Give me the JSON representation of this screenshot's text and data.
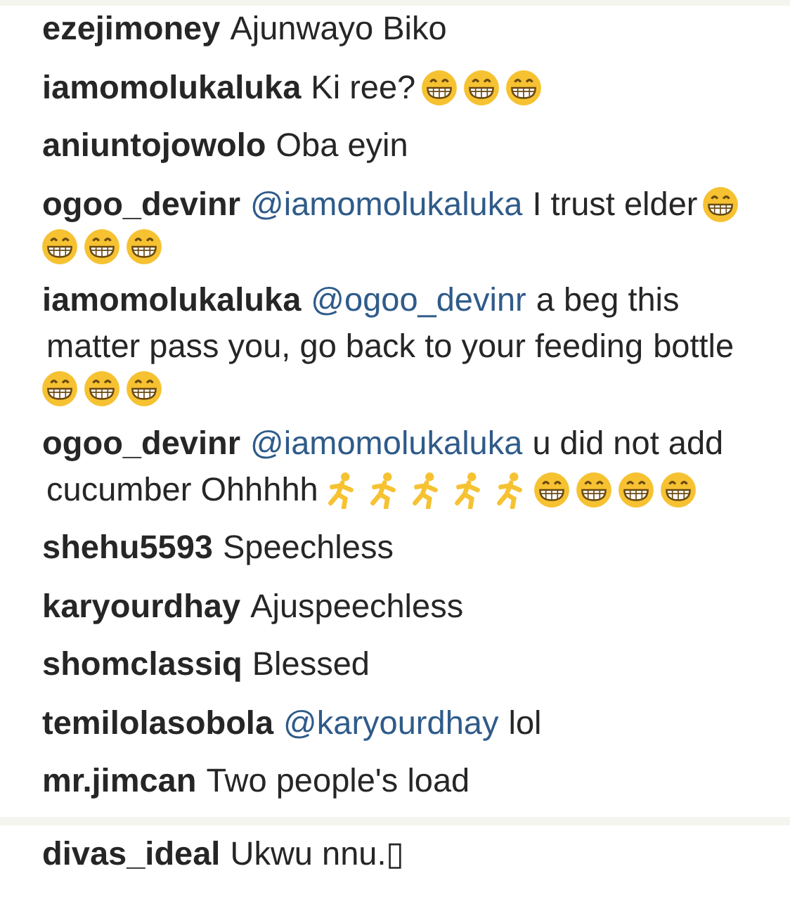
{
  "sections": [
    {
      "comments": [
        {
          "user": "ezejimoney",
          "parts": [
            {
              "kind": "text",
              "text": "Ajunwayo Biko"
            }
          ]
        },
        {
          "user": "iamomolukaluka",
          "parts": [
            {
              "kind": "text",
              "text": "Ki ree?"
            },
            {
              "kind": "grin"
            },
            {
              "kind": "grin"
            },
            {
              "kind": "grin"
            }
          ]
        },
        {
          "user": "aniuntojowolo",
          "parts": [
            {
              "kind": "text",
              "text": "Oba eyin"
            }
          ]
        },
        {
          "user": "ogoo_devinr",
          "parts": [
            {
              "kind": "mention",
              "text": "@iamomolukaluka"
            },
            {
              "kind": "text",
              "text": "I trust elder"
            },
            {
              "kind": "grin"
            },
            {
              "kind": "grin"
            },
            {
              "kind": "grin"
            },
            {
              "kind": "grin"
            }
          ]
        },
        {
          "user": "iamomolukaluka",
          "parts": [
            {
              "kind": "mention",
              "text": "@ogoo_devinr"
            },
            {
              "kind": "text",
              "text": "a beg this"
            },
            {
              "kind": "text",
              "text": "matter pass you, go back to your feeding"
            },
            {
              "kind": "text",
              "text": "bottle"
            },
            {
              "kind": "grin"
            },
            {
              "kind": "grin"
            },
            {
              "kind": "grin"
            }
          ]
        },
        {
          "user": "ogoo_devinr",
          "parts": [
            {
              "kind": "mention",
              "text": "@iamomolukaluka"
            },
            {
              "kind": "text",
              "text": "u did not add"
            },
            {
              "kind": "text",
              "text": "cucumber Ohhhhh"
            },
            {
              "kind": "run"
            },
            {
              "kind": "run"
            },
            {
              "kind": "run"
            },
            {
              "kind": "run"
            },
            {
              "kind": "run"
            },
            {
              "kind": "grin"
            },
            {
              "kind": "grin"
            },
            {
              "kind": "grin"
            },
            {
              "kind": "grin"
            }
          ]
        },
        {
          "user": "shehu5593",
          "parts": [
            {
              "kind": "text",
              "text": "Speechless"
            }
          ]
        },
        {
          "user": "karyourdhay",
          "parts": [
            {
              "kind": "text",
              "text": "Ajuspeechless"
            }
          ]
        },
        {
          "user": "shomclassiq",
          "parts": [
            {
              "kind": "text",
              "text": "Blessed"
            }
          ]
        },
        {
          "user": "temilolasobola",
          "parts": [
            {
              "kind": "mention",
              "text": "@karyourdhay"
            },
            {
              "kind": "text",
              "text": "lol"
            }
          ]
        },
        {
          "user": "mr.jimcan",
          "parts": [
            {
              "kind": "text",
              "text": "Two people's load"
            }
          ]
        }
      ]
    },
    {
      "comments": [
        {
          "user": "divas_ideal",
          "parts": [
            {
              "kind": "text",
              "text": "Ukwu nnu.▯"
            }
          ]
        }
      ]
    }
  ]
}
